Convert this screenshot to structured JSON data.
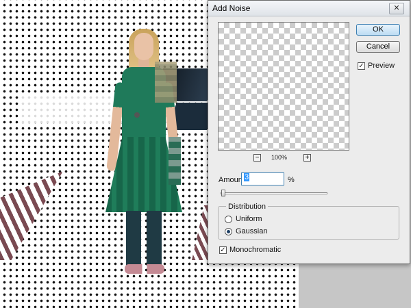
{
  "dialog": {
    "title": "Add Noise",
    "close_symbol": "✕",
    "zoom": {
      "out_symbol": "−",
      "level": "100%",
      "in_symbol": "+"
    },
    "ok_label": "OK",
    "cancel_label": "Cancel",
    "preview": {
      "label": "Preview",
      "checked": true,
      "check_symbol": "✓"
    },
    "amount": {
      "label": "Amount:",
      "value": "3",
      "unit": "%",
      "slider_fraction": 0.02
    },
    "distribution": {
      "legend": "Distribution",
      "options": [
        {
          "label": "Uniform",
          "selected": false
        },
        {
          "label": "Gaussian",
          "selected": true
        }
      ]
    },
    "monochromatic": {
      "label": "Monochromatic",
      "checked": true,
      "check_symbol": "✓"
    }
  },
  "colors": {
    "dialog_bg": "#ececec",
    "ok_accent": "#3c7fb1",
    "selection": "#3399ff",
    "dress": "#1f7a5a"
  }
}
